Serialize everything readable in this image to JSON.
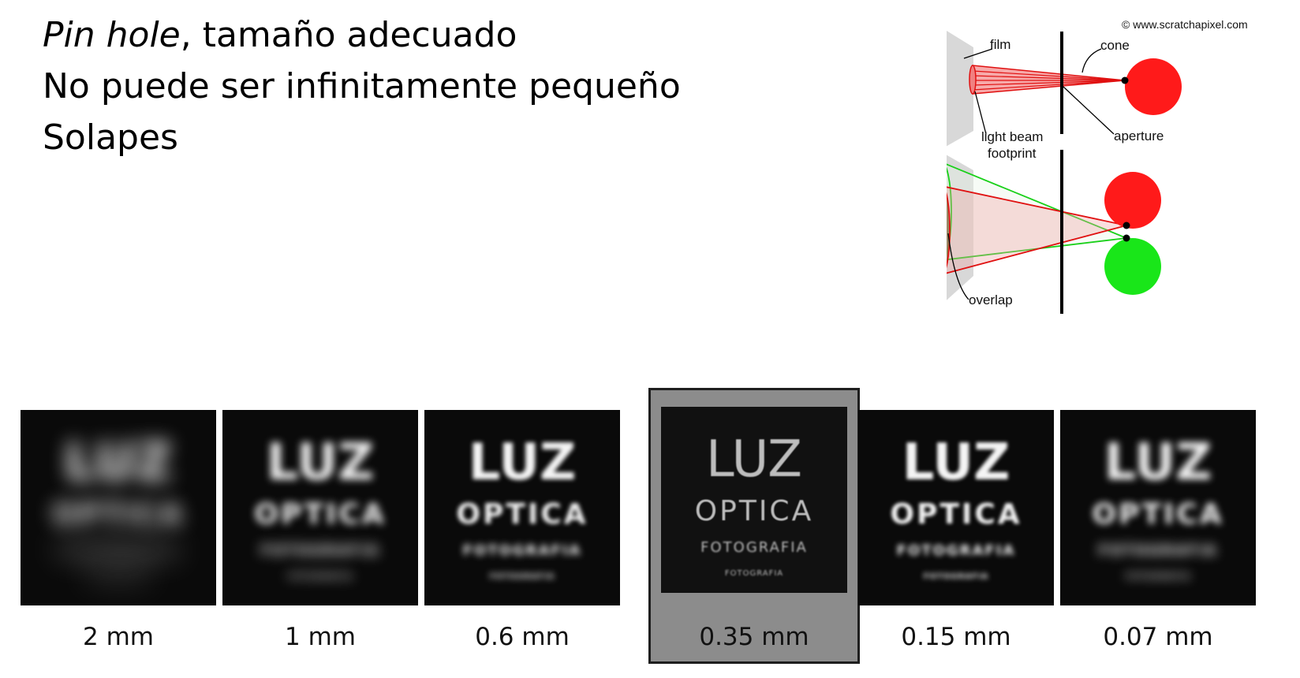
{
  "slide": {
    "bullets": [
      {
        "emph": "Pin hole",
        "rest": ", tamaño adecuado"
      },
      {
        "emph": "",
        "rest": "No puede ser infinitamente pequeño"
      },
      {
        "emph": "",
        "rest": "Solapes"
      }
    ]
  },
  "diagram": {
    "credit": "© www.scratchapixel.com",
    "labels": {
      "film": "film",
      "cone": "cone",
      "beam1": "light beam",
      "beam2": "footprint",
      "aperture": "aperture",
      "overlap": "overlap"
    },
    "colors": {
      "red": "#ff1a1a",
      "green": "#19e619",
      "film": "#d8d8d8"
    }
  },
  "photos": {
    "text_lines": [
      "LUZ",
      "OPTICA",
      "FOTOGRAFIA",
      "FOTOGRAFIA"
    ],
    "items": [
      {
        "caption": "2 mm",
        "blur": 12,
        "highlight": false
      },
      {
        "caption": "1 mm",
        "blur": 5,
        "highlight": false
      },
      {
        "caption": "0.6 mm",
        "blur": 2.6,
        "highlight": false
      },
      {
        "caption": "0.35 mm",
        "blur": 0.6,
        "highlight": true
      },
      {
        "caption": "0.15 mm",
        "blur": 2.2,
        "highlight": false
      },
      {
        "caption": "0.07 mm",
        "blur": 4.5,
        "highlight": false
      }
    ]
  }
}
